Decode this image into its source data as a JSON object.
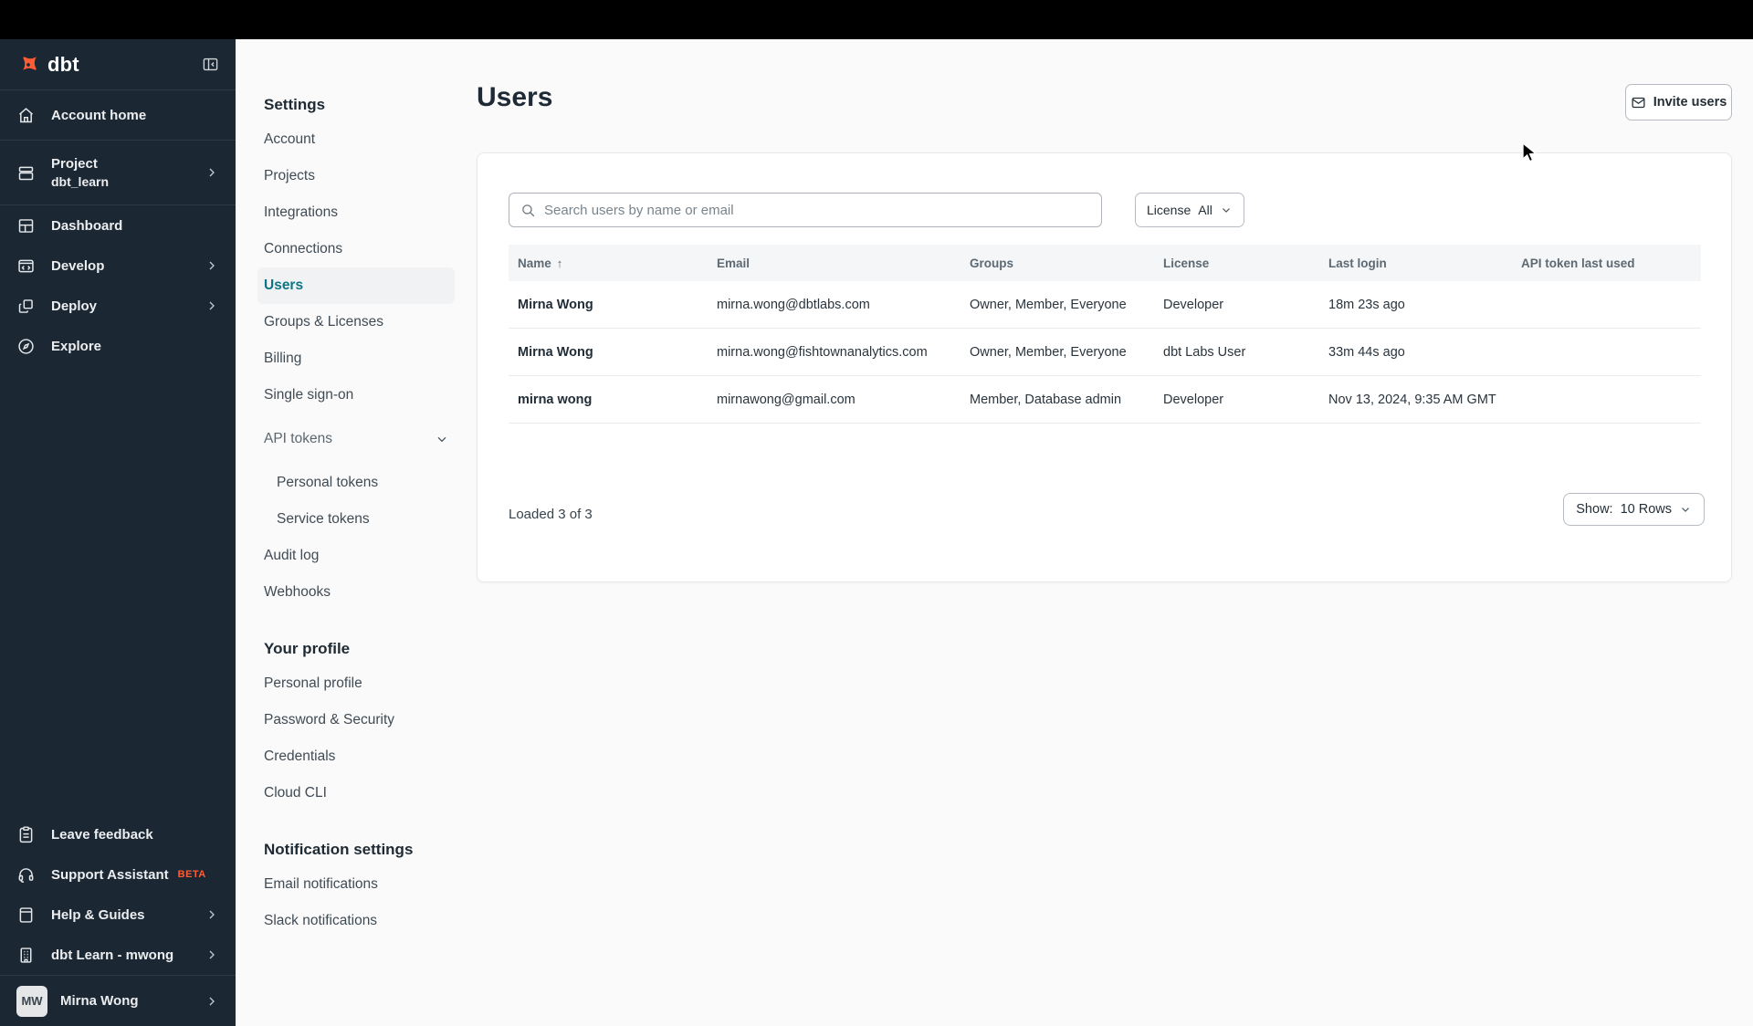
{
  "app": {
    "brand": "dbt",
    "accent_orange": "#ff5c35",
    "accent_teal": "#0e7683",
    "sidebar_bg": "#1b2733"
  },
  "sidebar": {
    "items": [
      {
        "label": "Account home",
        "icon": "home-icon"
      },
      {
        "label": "Project",
        "sublabel": "dbt_learn",
        "icon": "project-icon",
        "chevron": true
      },
      {
        "label": "Dashboard",
        "icon": "dashboard-icon"
      },
      {
        "label": "Develop",
        "icon": "develop-icon",
        "chevron": true
      },
      {
        "label": "Deploy",
        "icon": "deploy-icon",
        "chevron": true
      },
      {
        "label": "Explore",
        "icon": "explore-icon"
      }
    ],
    "footer_items": [
      {
        "label": "Leave feedback",
        "icon": "clipboard-icon"
      },
      {
        "label": "Support Assistant",
        "badge": "BETA",
        "icon": "headset-icon"
      },
      {
        "label": "Help & Guides",
        "icon": "book-icon",
        "chevron": true
      },
      {
        "label": "dbt Learn - mwong",
        "icon": "building-icon",
        "chevron": true
      }
    ],
    "user": {
      "initials": "MW",
      "name": "Mirna Wong"
    }
  },
  "settings_nav": {
    "title": "Settings",
    "items": [
      "Account",
      "Projects",
      "Integrations",
      "Connections",
      "Users",
      "Groups & Licenses",
      "Billing",
      "Single sign-on",
      "API tokens",
      "Personal tokens",
      "Service tokens",
      "Audit log",
      "Webhooks"
    ],
    "active_item": "Users",
    "profile_title": "Your profile",
    "profile_items": [
      "Personal profile",
      "Password & Security",
      "Credentials",
      "Cloud CLI"
    ],
    "notification_title": "Notification settings",
    "notification_items": [
      "Email notifications",
      "Slack notifications"
    ]
  },
  "main": {
    "title": "Users",
    "invite_button": "Invite users",
    "search_placeholder": "Search users by name or email",
    "license_filter": {
      "label": "License",
      "value": "All"
    },
    "table": {
      "columns": [
        "Name",
        "Email",
        "Groups",
        "License",
        "Last login",
        "API token last used"
      ],
      "sort_column": "Name",
      "sort_direction": "asc",
      "rows": [
        {
          "name": "Mirna Wong",
          "email": "mirna.wong@dbtlabs.com",
          "groups": "Owner, Member, Everyone",
          "license": "Developer",
          "last_login": "18m 23s ago",
          "api_token_last_used": ""
        },
        {
          "name": "Mirna Wong",
          "email": "mirna.wong@fishtownanalytics.com",
          "groups": "Owner, Member, Everyone",
          "license": "dbt Labs User",
          "last_login": "33m 44s ago",
          "api_token_last_used": ""
        },
        {
          "name": "mirna wong",
          "email": "mirnawong@gmail.com",
          "groups": "Member, Database admin",
          "license": "Developer",
          "last_login": "Nov 13, 2024, 9:35 AM GMT",
          "api_token_last_used": ""
        }
      ]
    },
    "footer": {
      "loaded_text": "Loaded 3 of 3",
      "show_label": "Show:",
      "show_value": "10 Rows"
    }
  }
}
